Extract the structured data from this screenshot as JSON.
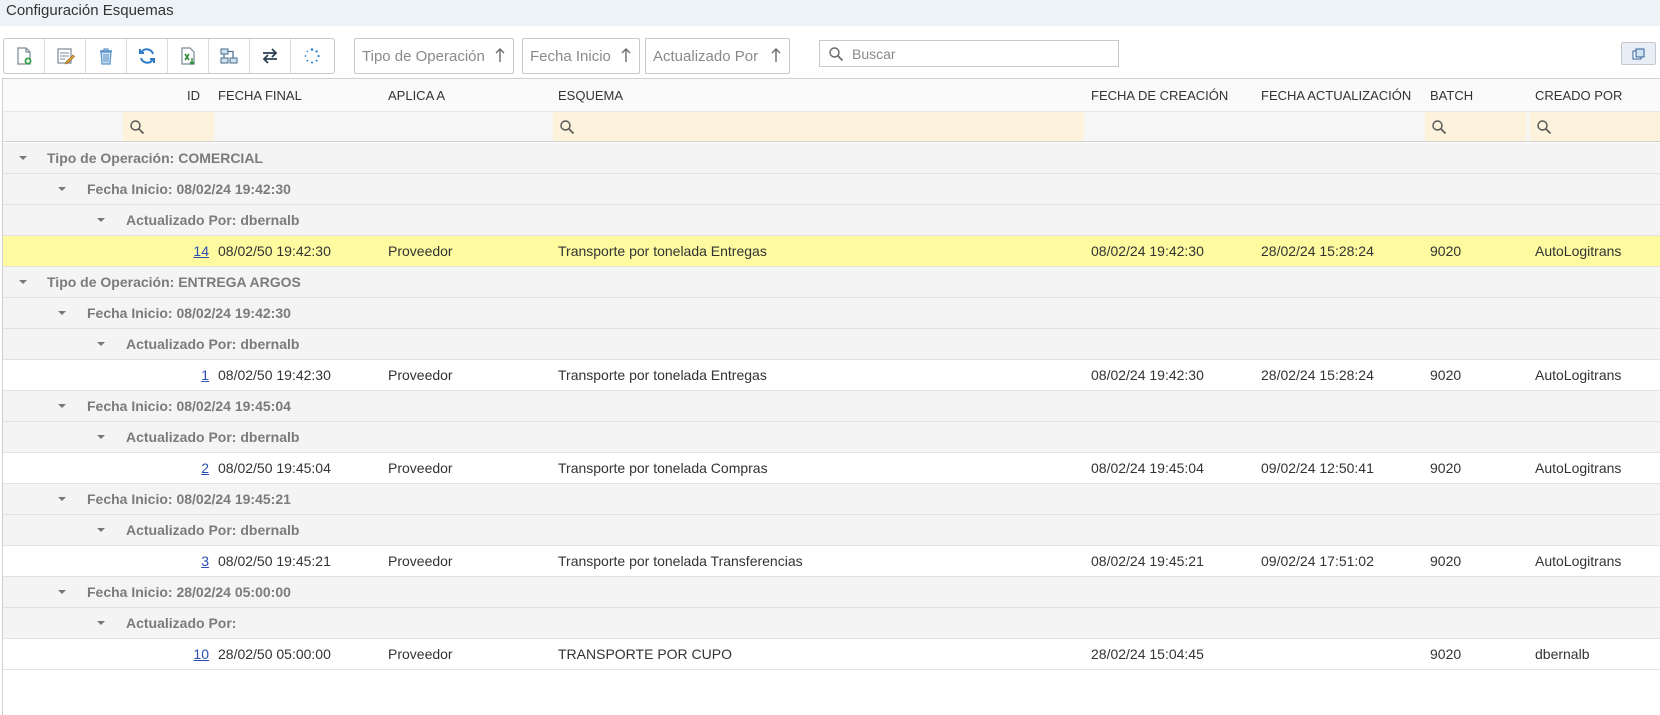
{
  "window": {
    "title": "Configuración Esquemas"
  },
  "toolbar": {
    "buttons": [
      {
        "icon": "new-document-icon"
      },
      {
        "icon": "edit-icon"
      },
      {
        "icon": "delete-icon"
      },
      {
        "icon": "refresh-icon"
      },
      {
        "icon": "excel-export-icon"
      },
      {
        "icon": "hierarchy-icon"
      },
      {
        "icon": "swap-icon"
      },
      {
        "icon": "loading-icon"
      }
    ]
  },
  "grouping": {
    "chips": [
      {
        "label": "Tipo de Operación",
        "sort": "ascending"
      },
      {
        "label": "Fecha Inicio",
        "sort": "ascending"
      },
      {
        "label": "Actualizado Por",
        "sort": "ascending"
      }
    ]
  },
  "search": {
    "placeholder": "Buscar",
    "value": ""
  },
  "grid": {
    "columns": [
      "ID",
      "FECHA FINAL",
      "APLICA A",
      "ESQUEMA",
      "FECHA DE CREACIÓN",
      "FECHA ACTUALIZACIÓN",
      "BATCH",
      "CREADO POR"
    ],
    "rows": [
      {
        "type": "group",
        "level": 0,
        "label": "Tipo de Operación: COMERCIAL"
      },
      {
        "type": "group",
        "level": 1,
        "label": "Fecha Inicio: 08/02/24 19:42:30"
      },
      {
        "type": "group",
        "level": 2,
        "label": "Actualizado Por: dbernalb"
      },
      {
        "type": "data",
        "selected": true,
        "id": "14",
        "fecha_final": "08/02/50 19:42:30",
        "aplica_a": "Proveedor",
        "esquema": "Transporte por tonelada Entregas",
        "fecha_creacion": "08/02/24 19:42:30",
        "fecha_actualizacion": "28/02/24 15:28:24",
        "batch": "9020",
        "creado_por": "AutoLogitrans"
      },
      {
        "type": "group",
        "level": 0,
        "label": "Tipo de Operación: ENTREGA ARGOS"
      },
      {
        "type": "group",
        "level": 1,
        "label": "Fecha Inicio: 08/02/24 19:42:30"
      },
      {
        "type": "group",
        "level": 2,
        "label": "Actualizado Por: dbernalb"
      },
      {
        "type": "data",
        "selected": false,
        "id": "1",
        "fecha_final": "08/02/50 19:42:30",
        "aplica_a": "Proveedor",
        "esquema": "Transporte por tonelada Entregas",
        "fecha_creacion": "08/02/24 19:42:30",
        "fecha_actualizacion": "28/02/24 15:28:24",
        "batch": "9020",
        "creado_por": "AutoLogitrans"
      },
      {
        "type": "group",
        "level": 1,
        "label": "Fecha Inicio: 08/02/24 19:45:04"
      },
      {
        "type": "group",
        "level": 2,
        "label": "Actualizado Por: dbernalb"
      },
      {
        "type": "data",
        "selected": false,
        "id": "2",
        "fecha_final": "08/02/50 19:45:04",
        "aplica_a": "Proveedor",
        "esquema": "Transporte por tonelada Compras",
        "fecha_creacion": "08/02/24 19:45:04",
        "fecha_actualizacion": "09/02/24 12:50:41",
        "batch": "9020",
        "creado_por": "AutoLogitrans"
      },
      {
        "type": "group",
        "level": 1,
        "label": "Fecha Inicio: 08/02/24 19:45:21"
      },
      {
        "type": "group",
        "level": 2,
        "label": "Actualizado Por: dbernalb"
      },
      {
        "type": "data",
        "selected": false,
        "id": "3",
        "fecha_final": "08/02/50 19:45:21",
        "aplica_a": "Proveedor",
        "esquema": "Transporte por tonelada Transferencias",
        "fecha_creacion": "08/02/24 19:45:21",
        "fecha_actualizacion": "09/02/24 17:51:02",
        "batch": "9020",
        "creado_por": "AutoLogitrans"
      },
      {
        "type": "group",
        "level": 1,
        "label": "Fecha Inicio: 28/02/24 05:00:00"
      },
      {
        "type": "group",
        "level": 2,
        "label": "Actualizado Por:"
      },
      {
        "type": "data",
        "selected": false,
        "id": "10",
        "fecha_final": "28/02/50 05:00:00",
        "aplica_a": "Proveedor",
        "esquema": "TRANSPORTE POR CUPO",
        "fecha_creacion": "28/02/24 15:04:45",
        "fecha_actualizacion": "",
        "batch": "9020",
        "creado_por": "dbernalb"
      }
    ]
  },
  "colors": {
    "selected_row": "#fdfaa0",
    "filter_cell": "#fdf3dc",
    "link": "#2b4fb0",
    "group_text": "#7b7b7b"
  }
}
